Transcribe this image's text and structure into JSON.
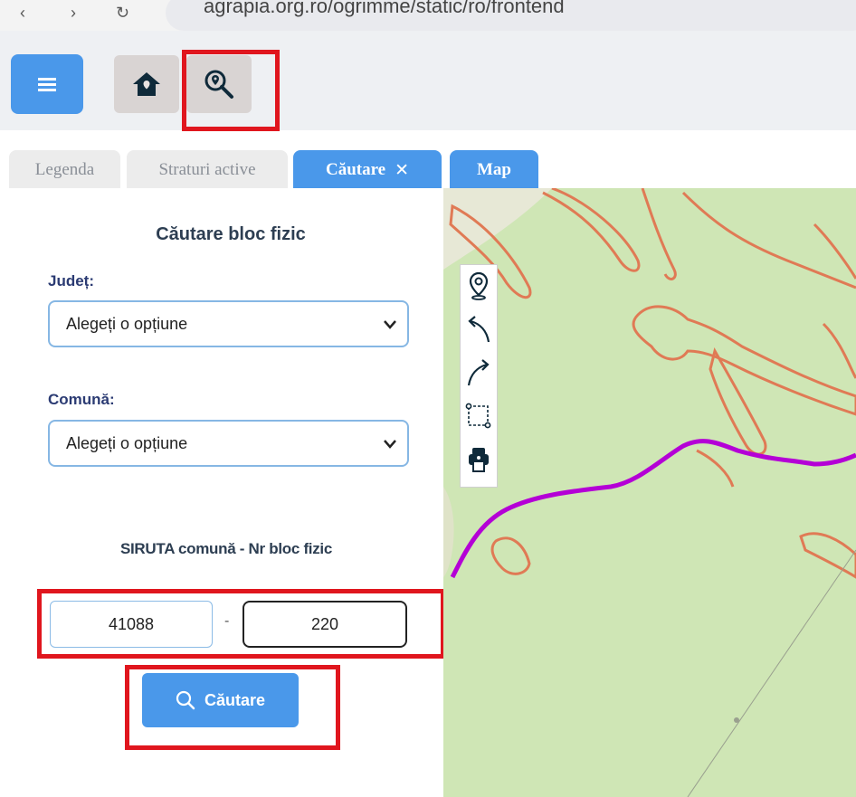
{
  "browser": {
    "url": "agrapia.org.ro/ogrimme/static/ro/frontend"
  },
  "toolbar": {
    "menu_icon": "menu-icon",
    "home_icon": "home-icon",
    "search_icon": "search-location-icon"
  },
  "tabs": [
    {
      "label": "Legenda",
      "active": false
    },
    {
      "label": "Straturi active",
      "active": false
    },
    {
      "label": "Căutare",
      "active": true,
      "close": "✕"
    },
    {
      "label": "Map",
      "active": false
    }
  ],
  "search_panel": {
    "title": "Căutare bloc fizic",
    "judet_label": "Județ:",
    "judet_value": "Alegeți o opțiune",
    "comuna_label": "Comună:",
    "comuna_value": "Alegeți o opțiune",
    "siruta_label": "SIRUTA comună - Nr bloc fizic",
    "siruta_value": "41088",
    "separator": "-",
    "bloc_value": "220",
    "submit_label": "Căutare"
  },
  "map_tools": [
    "location-pin-icon",
    "undo-arrow-icon",
    "redo-arrow-icon",
    "draw-rectangle-icon",
    "print-icon"
  ],
  "colors": {
    "accent": "#4a98ea",
    "highlight": "#e0161e",
    "map_green": "#cfe6b5",
    "parcel_outline": "#e07a55",
    "route": "#b400d6"
  }
}
